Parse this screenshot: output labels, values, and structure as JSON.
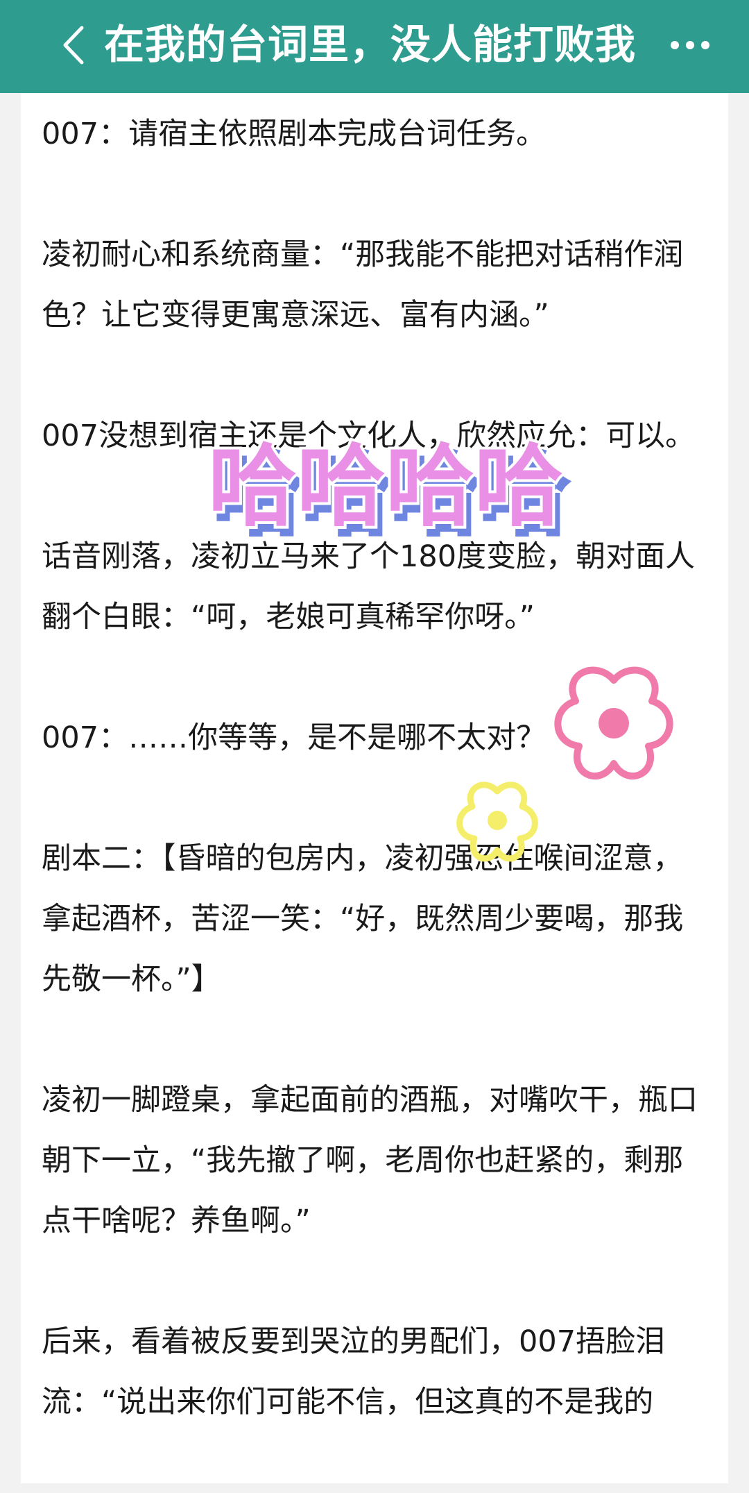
{
  "header": {
    "title": "在我的台词里，没人能打败我",
    "back_icon": "chevron-left-icon",
    "more_icon": "more-dots-icon",
    "background_color": "#2e9c8f"
  },
  "paragraphs": [
    "007：请宿主依照剧本完成台词任务。",
    "凌初耐心和系统商量：“那我能不能把对话稍作润色？让它变得更寓意深远、富有内涵。”",
    "007没想到宿主还是个文化人，欣然应允：可以。",
    "话音刚落，凌初立马来了个180度变脸，朝对面人翻个白眼：“呵，老娘可真稀罕你呀。”",
    "007：……你等等，是不是哪不太对？",
    "剧本二：【昏暗的包房内，凌初强忍住喉间涩意，拿起酒杯，苦涩一笑：“好，既然周少要喝，那我先敬一杯。”】",
    "凌初一脚蹬桌，拿起面前的酒瓶，对嘴吹干，瓶口朝下一立，“我先撤了啊，老周你也赶紧的，剩那点干啥呢？养鱼啊。”",
    "后来，看着被反要到哭泣的男配们，007捂脸泪流：“说出来你们可能不信，但这真的不是我的"
  ],
  "stickers": {
    "haha_text": "哈哈哈哈",
    "haha_color": "#e98fe6",
    "haha_shadow_color": "#6f86e0",
    "pink_flower_color": "#f07aaa",
    "yellow_flower_color": "#f5ee6a"
  }
}
